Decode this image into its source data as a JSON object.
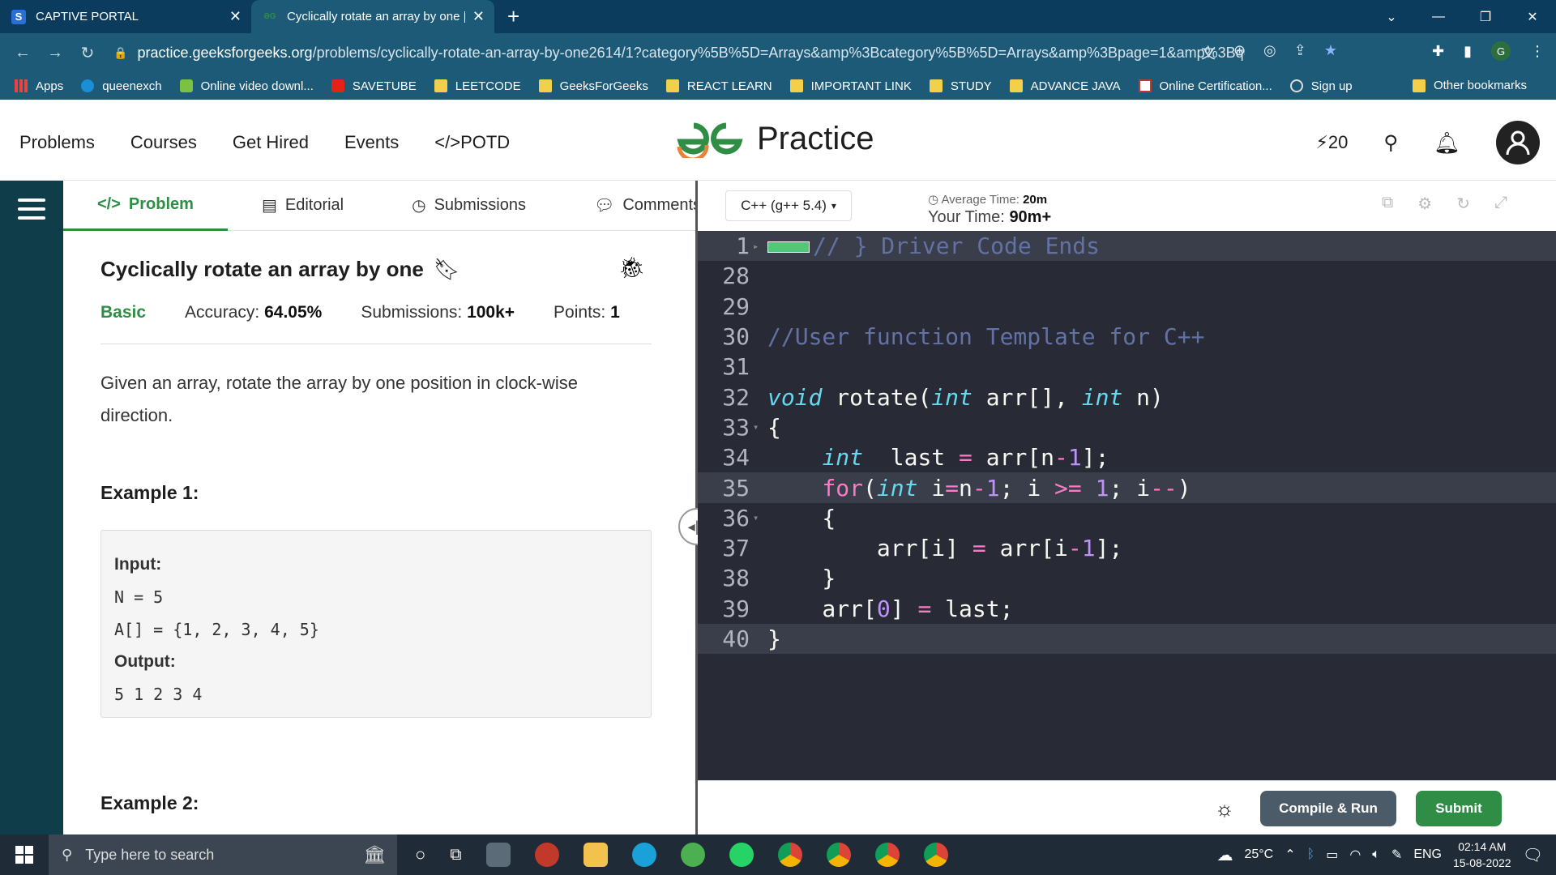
{
  "browser": {
    "tabs": [
      {
        "title": "CAPTIVE PORTAL",
        "favicon": "S"
      },
      {
        "title": "Cyclically rotate an array by one |",
        "favicon": "GfG"
      }
    ],
    "url_host": "practice.geeksforgeeks.org",
    "url_path": "/problems/cyclically-rotate-an-array-by-one2614/1?category%5B%5D=Arrays&amp%3Bcategory%5B%5D=Arrays&amp%3Bpage=1&amp%3Bquer...",
    "profile_initial": "G"
  },
  "bookmarks": [
    "Apps",
    "queenexch",
    "Online video downl...",
    "SAVETUBE",
    "LEETCODE",
    "GeeksForGeeks",
    "REACT LEARN",
    "IMPORTANT LINK",
    "STUDY",
    "ADVANCE JAVA",
    "Online Certification...",
    "Sign up"
  ],
  "bookmarks_other": "Other bookmarks",
  "header": {
    "nav": [
      "Problems",
      "Courses",
      "Get Hired",
      "Events"
    ],
    "potd": "</>POTD",
    "logo_text": "Practice",
    "streak": "20"
  },
  "problem_tabs": [
    "Problem",
    "Editorial",
    "Submissions",
    "Comments"
  ],
  "problem": {
    "title": "Cyclically rotate an array by one",
    "difficulty": "Basic",
    "accuracy_label": "Accuracy:",
    "accuracy": "64.05%",
    "submissions_label": "Submissions:",
    "submissions": "100k+",
    "points_label": "Points:",
    "points": "1",
    "description": "Given an array, rotate the array by one position in clock-wise direction.",
    "example1_heading": "Example 1:",
    "input_label": "Input:",
    "input_line1": "N = 5",
    "input_line2": "A[] = {1, 2, 3, 4, 5}",
    "output_label": "Output:",
    "output_value": "5 1 2 3 4",
    "example2_heading": "Example 2:"
  },
  "editor": {
    "language": "C++ (g++ 5.4)",
    "avg_time_label": "Average Time:",
    "avg_time": "20m",
    "your_time_label": "Your Time:",
    "your_time": "90m+",
    "compile_label": "Compile & Run",
    "submit_label": "Submit"
  },
  "taskbar": {
    "search_placeholder": "Type here to search",
    "temperature": "25°C",
    "language": "ENG",
    "time": "02:14 AM",
    "date": "15-08-2022"
  }
}
